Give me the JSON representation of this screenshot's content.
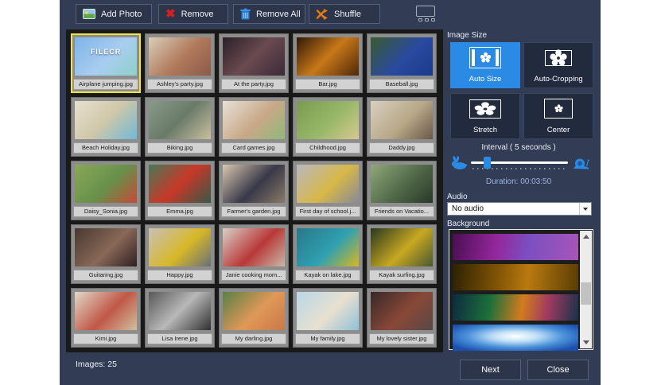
{
  "colors": {
    "accent": "#2b8be4",
    "selection": "#f3e43b",
    "window_bg": "#323c54",
    "grid_bg": "#191919"
  },
  "toolbar": {
    "buttons": [
      {
        "label": "Add Photo"
      },
      {
        "label": "Remove"
      },
      {
        "label": "Remove All"
      },
      {
        "label": "Shuffle"
      }
    ]
  },
  "photo_grid": {
    "selected_index": 0,
    "items": [
      {
        "filename": "Airplane jumping.jpg",
        "watermark": "FILECR",
        "colors": [
          "#7db4e8",
          "#a9cdf0 55%",
          "#8fd0c8"
        ]
      },
      {
        "filename": "Ashley's party.jpg",
        "colors": [
          "#d8cdb8",
          "#b0785a 55%",
          "#8a5a48"
        ]
      },
      {
        "filename": "At the party.jpg",
        "colors": [
          "#2a2028",
          "#6a4a50 50%",
          "#3a2a35"
        ]
      },
      {
        "filename": "Bar.jpg",
        "colors": [
          "#301808",
          "#c87818 50%",
          "#502808"
        ]
      },
      {
        "filename": "Baseball.jpg",
        "colors": [
          "#3a5a30",
          "#2a4aa0 55%",
          "#1a3a8a"
        ]
      },
      {
        "filename": "Beach Holiday.jpg",
        "colors": [
          "#e8e0d0",
          "#d0c8a8 50%",
          "#70b8d8"
        ]
      },
      {
        "filename": "Biking.jpg",
        "colors": [
          "#8a9a88",
          "#6a7a68 50%",
          "#c8c0a0"
        ]
      },
      {
        "filename": "Card games.jpg",
        "colors": [
          "#e8e0d8",
          "#c8a888 55%",
          "#90b878"
        ]
      },
      {
        "filename": "Childhood.jpg",
        "colors": [
          "#7a9a50",
          "#98b868 55%",
          "#d8c890"
        ]
      },
      {
        "filename": "Daddy.jpg",
        "colors": [
          "#d8d0c0",
          "#b8a888 55%",
          "#6a5848"
        ]
      },
      {
        "filename": "Daisy_Sonia.jpg",
        "colors": [
          "#88a858",
          "#68904a 55%",
          "#c84838"
        ]
      },
      {
        "filename": "Emma.jpg",
        "colors": [
          "#487858",
          "#c83828 50%",
          "#385848"
        ]
      },
      {
        "filename": "Farmer's garden.jpg",
        "colors": [
          "#d8c8b0",
          "#383848 55%",
          "#8a7a68"
        ]
      },
      {
        "filename": "First day of school.j...",
        "colors": [
          "#b8b8c0",
          "#d8b848 55%",
          "#888898"
        ]
      },
      {
        "filename": "Friends on Vacatio...",
        "colors": [
          "#90a878",
          "#506848 55%",
          "#283828"
        ]
      },
      {
        "filename": "Guitaring.jpg",
        "colors": [
          "#483830",
          "#886858 55%",
          "#302020"
        ]
      },
      {
        "filename": "Happy.jpg",
        "colors": [
          "#c8c0b8",
          "#d8b828 55%",
          "#687078"
        ]
      },
      {
        "filename": "Janie cooking mom...",
        "colors": [
          "#d8d0c8",
          "#b83838 55%",
          "#c8b8a8"
        ]
      },
      {
        "filename": "Kayak on lake.jpg",
        "colors": [
          "#287888",
          "#30a0b0 55%",
          "#d8b820"
        ]
      },
      {
        "filename": "Kayak surfing.jpg",
        "colors": [
          "#283820",
          "#c8a820 55%",
          "#485830"
        ]
      },
      {
        "filename": "Kimi.jpg",
        "colors": [
          "#e0d8c8",
          "#c05848 55%",
          "#d0c0a0"
        ]
      },
      {
        "filename": "Lisa Irene.jpg",
        "colors": [
          "#585858",
          "#b8b8b8 50%",
          "#303030"
        ]
      },
      {
        "filename": "My darling.jpg",
        "colors": [
          "#588048",
          "#e09858 55%",
          "#c87848"
        ]
      },
      {
        "filename": "My family.jpg",
        "colors": [
          "#b8d8e8",
          "#e8e0d0 55%",
          "#90c0d8"
        ]
      },
      {
        "filename": "My lovely sister.jpg",
        "colors": [
          "#382828",
          "#884838 55%",
          "#584848"
        ]
      }
    ]
  },
  "sidebar": {
    "image_size": {
      "label": "Image Size",
      "options": [
        {
          "label": "Auto Size",
          "selected": true
        },
        {
          "label": "Auto-Cropping",
          "selected": false
        },
        {
          "label": "Stretch",
          "selected": false
        },
        {
          "label": "Center",
          "selected": false
        }
      ]
    },
    "interval": {
      "label_text": "Interval  ( 5 seconds )",
      "duration": "Duration: 00:03:50",
      "slider_percent": 13
    },
    "audio": {
      "label": "Audio",
      "selected_value": "No audio"
    },
    "background": {
      "label": "Background",
      "items": [
        {
          "name": "purple-galaxy-thumbnail",
          "angle": 100,
          "colors": [
            "#4a0e52",
            "#93279b 35%",
            "#7b4fc0 60%",
            "#a855b8"
          ]
        },
        {
          "name": "gold-confetti-thumbnail",
          "angle": 95,
          "colors": [
            "#2e2103",
            "#8a5a06 40%",
            "#b97a10 60%",
            "#5a3c04"
          ]
        },
        {
          "name": "bokeh-lights-thumbnail",
          "angle": 100,
          "colors": [
            "#0d2a40",
            "#1c6f3a 30%",
            "#d27b1e 55%",
            "#a03a60 75%",
            "#16324a"
          ]
        },
        {
          "name": "blue-burst-thumbnail",
          "style": "radial",
          "colors": [
            "#ffffff",
            "#bfe0f7 25%",
            "#4a90d9 55%",
            "#1a4fae 85%"
          ]
        }
      ]
    }
  },
  "footer": {
    "images_count": "Images: 25",
    "next_label": "Next",
    "close_label": "Close"
  }
}
